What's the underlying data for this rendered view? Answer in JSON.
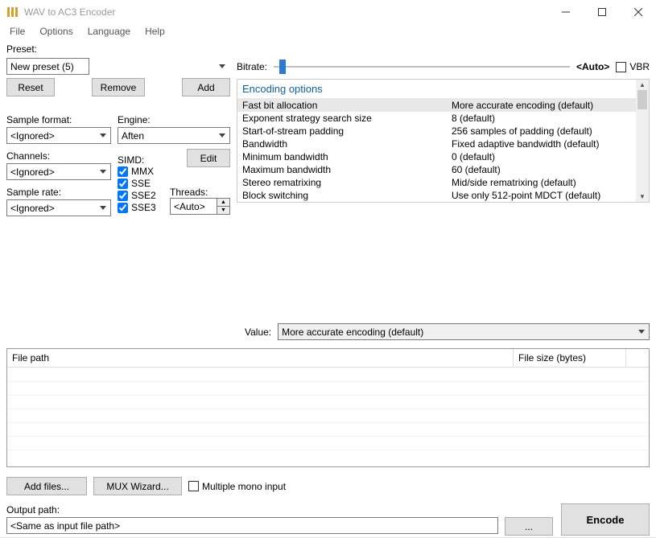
{
  "window": {
    "title": "WAV to AC3 Encoder"
  },
  "menu": {
    "file": "File",
    "options": "Options",
    "language": "Language",
    "help": "Help"
  },
  "preset": {
    "label": "Preset:",
    "value": "New preset (5)",
    "reset": "Reset",
    "remove": "Remove",
    "add": "Add"
  },
  "left": {
    "sample_format_label": "Sample format:",
    "sample_format_value": "<Ignored>",
    "channels_label": "Channels:",
    "channels_value": "<Ignored>",
    "sample_rate_label": "Sample rate:",
    "sample_rate_value": "<Ignored>",
    "engine_label": "Engine:",
    "engine_value": "Aften",
    "edit_btn": "Edit",
    "simd_label": "SIMD:",
    "simd_mmx": "MMX",
    "simd_sse": "SSE",
    "simd_sse2": "SSE2",
    "simd_sse3": "SSE3",
    "threads_label": "Threads:",
    "threads_value": "<Auto>"
  },
  "bitrate": {
    "label": "Bitrate:",
    "auto": "<Auto>",
    "vbr": "VBR"
  },
  "encoding": {
    "header": "Encoding options",
    "rows": [
      {
        "name": "Fast bit allocation",
        "val": "More accurate encoding (default)"
      },
      {
        "name": "Exponent strategy search size",
        "val": "8 (default)"
      },
      {
        "name": "Start-of-stream padding",
        "val": "256 samples of padding (default)"
      },
      {
        "name": "Bandwidth",
        "val": "Fixed adaptive bandwidth (default)"
      },
      {
        "name": "Minimum bandwidth",
        "val": "0 (default)"
      },
      {
        "name": "Maximum bandwidth",
        "val": "60 (default)"
      },
      {
        "name": "Stereo rematrixing",
        "val": "Mid/side rematrixing (default)"
      },
      {
        "name": "Block switching",
        "val": "Use only 512-point MDCT (default)"
      }
    ]
  },
  "value_row": {
    "label": "Value:",
    "value": "More accurate encoding (default)"
  },
  "files": {
    "col1": "File path",
    "col2": "File size (bytes)"
  },
  "bottom": {
    "add_files": "Add files...",
    "mux_wizard": "MUX Wizard...",
    "mono": "Multiple mono input"
  },
  "output": {
    "label": "Output path:",
    "value": "<Same as input file path>",
    "browse": "...",
    "encode": "Encode"
  }
}
